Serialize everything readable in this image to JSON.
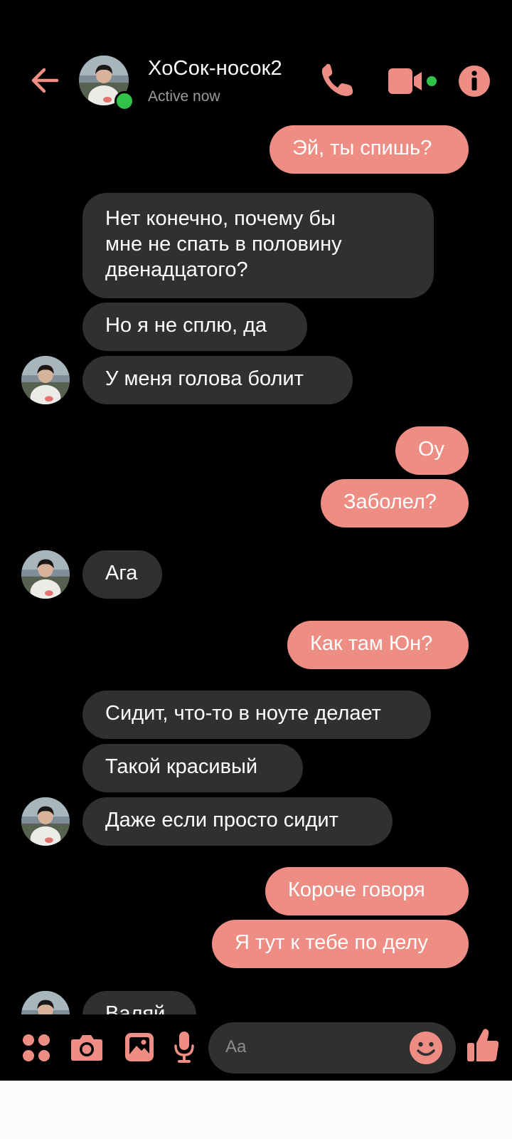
{
  "header": {
    "contact_name": "ХоСок-носок2",
    "status": "Active now"
  },
  "messages": [
    {
      "side": "out",
      "text": "Эй, ты спишь?"
    },
    {
      "side": "in",
      "text": "Нет конечно, почему бы\nмне не спать в половину\nдвенадцатого?"
    },
    {
      "side": "in",
      "text": "Но я не сплю, да"
    },
    {
      "side": "in",
      "text": "У меня голова болит"
    },
    {
      "side": "out",
      "text": "Оу"
    },
    {
      "side": "out",
      "text": "Заболел?"
    },
    {
      "side": "in",
      "text": "Ага"
    },
    {
      "side": "out",
      "text": "Как там Юн?"
    },
    {
      "side": "in",
      "text": "Сидит, что-то в ноуте делает"
    },
    {
      "side": "in",
      "text": "Такой красивый"
    },
    {
      "side": "in",
      "text": "Даже если просто сидит"
    },
    {
      "side": "out",
      "text": "Короче говоря"
    },
    {
      "side": "out",
      "text": "Я тут к тебе по делу"
    },
    {
      "side": "in",
      "text": "Валяй"
    }
  ],
  "composer": {
    "placeholder": "Aa"
  },
  "colors": {
    "accent": "#ee8d83",
    "incoming_bubble": "#303030",
    "background": "#000000",
    "online": "#31c24a"
  }
}
